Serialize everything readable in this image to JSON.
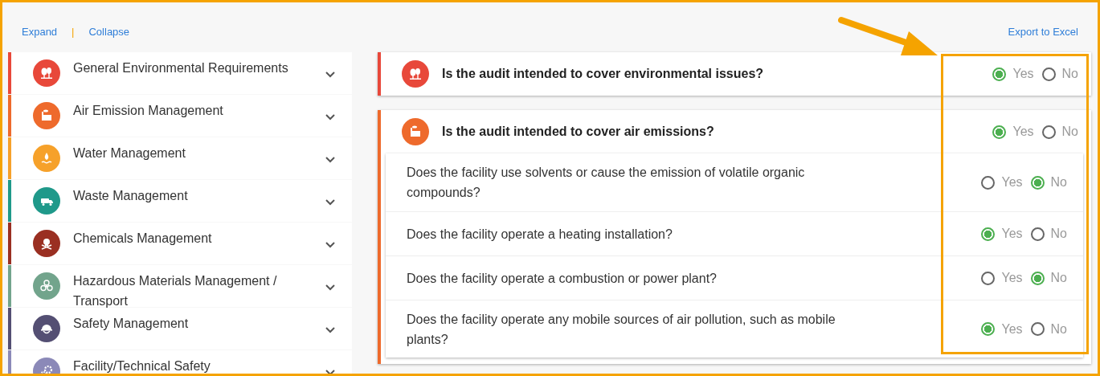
{
  "toolbar": {
    "expand": "Expand",
    "separator": "|",
    "collapse": "Collapse",
    "export": "Export to Excel"
  },
  "categories": [
    {
      "label": "General Environmental Requirements",
      "color": "#e8483a"
    },
    {
      "label": "Air Emission Management",
      "color": "#ee6a2c"
    },
    {
      "label": "Water Management",
      "color": "#f6a12a"
    },
    {
      "label": "Waste Management",
      "color": "#1f998a"
    },
    {
      "label": "Chemicals Management",
      "color": "#9a2f22"
    },
    {
      "label": "Hazardous Materials Management / Transport",
      "color": "#72a48c"
    },
    {
      "label": "Safety Management",
      "color": "#544f73"
    },
    {
      "label": "Facility/Technical Safety",
      "color": "#8b89b8"
    }
  ],
  "sections": [
    {
      "question": "Is the audit intended to cover environmental issues?",
      "color": "#e8483a",
      "options": [
        {
          "label": "Yes",
          "selected": true
        },
        {
          "label": "No",
          "selected": false
        }
      ]
    },
    {
      "question": "Is the audit intended to cover air emissions?",
      "color": "#ee6a2c",
      "options": [
        {
          "label": "Yes",
          "selected": true
        },
        {
          "label": "No",
          "selected": false
        }
      ],
      "subquestions": [
        {
          "question": "Does the facility use solvents or cause the emission of volatile organic compounds?",
          "options": [
            {
              "label": "Yes",
              "selected": false
            },
            {
              "label": "No",
              "selected": true
            }
          ]
        },
        {
          "question": "Does the facility operate a heating installation?",
          "options": [
            {
              "label": "Yes",
              "selected": true
            },
            {
              "label": "No",
              "selected": false
            }
          ]
        },
        {
          "question": "Does the facility operate a combustion or power plant?",
          "options": [
            {
              "label": "Yes",
              "selected": false
            },
            {
              "label": "No",
              "selected": true
            }
          ]
        },
        {
          "question": "Does the facility operate any mobile sources of air pollution, such as mobile plants?",
          "options": [
            {
              "label": "Yes",
              "selected": true
            },
            {
              "label": "No",
              "selected": false
            }
          ]
        }
      ]
    }
  ]
}
